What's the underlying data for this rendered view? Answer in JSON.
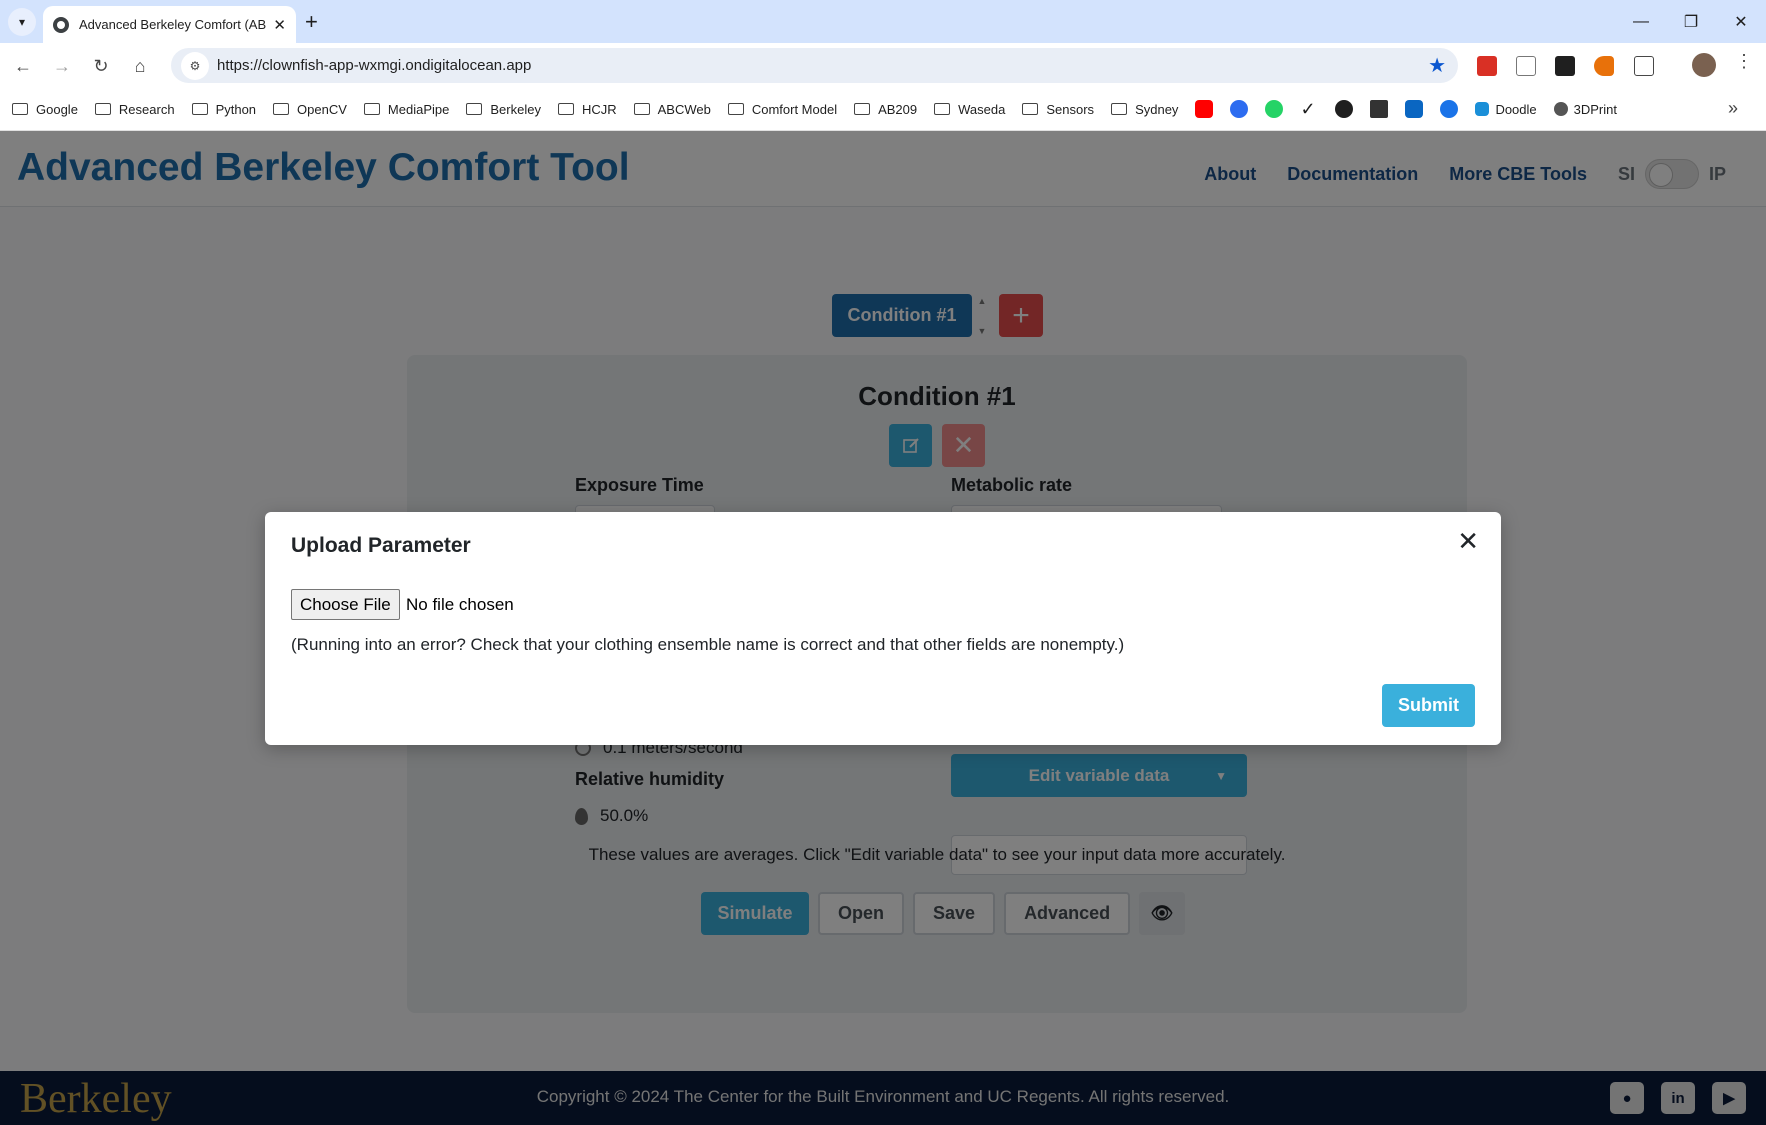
{
  "browser": {
    "tab_title": "Advanced Berkeley Comfort (AB",
    "url": "https://clownfish-app-wxmgi.ondigitalocean.app",
    "bookmarks": [
      {
        "label": "Google",
        "type": "folder"
      },
      {
        "label": "Research",
        "type": "folder"
      },
      {
        "label": "Python",
        "type": "folder"
      },
      {
        "label": "OpenCV",
        "type": "folder"
      },
      {
        "label": "MediaPipe",
        "type": "folder"
      },
      {
        "label": "Berkeley",
        "type": "folder"
      },
      {
        "label": "HCJR",
        "type": "folder"
      },
      {
        "label": "ABCWeb",
        "type": "folder"
      },
      {
        "label": "Comfort Model",
        "type": "folder"
      },
      {
        "label": "AB209",
        "type": "folder"
      },
      {
        "label": "Waseda",
        "type": "folder"
      },
      {
        "label": "Sensors",
        "type": "folder"
      },
      {
        "label": "Sydney",
        "type": "folder"
      }
    ],
    "bookmark_icons": [
      {
        "name": "youtube-bookmark-icon",
        "color": "#ff0000"
      },
      {
        "name": "zoom-bookmark-icon",
        "color": "#2d6cf0"
      },
      {
        "name": "whatsapp-bookmark-icon",
        "color": "#25d366"
      },
      {
        "name": "checkmark-bookmark-icon",
        "color": "#1f1f1f"
      },
      {
        "name": "github-bookmark-icon",
        "color": "#1f1f1f"
      },
      {
        "name": "layers-bookmark-icon",
        "color": "#333333"
      },
      {
        "name": "linkedin-bookmark-icon",
        "color": "#0a66c2"
      },
      {
        "name": "circle-bookmark-icon",
        "color": "#1a73e8"
      }
    ],
    "doodle_label": "Doodle",
    "print_label": "3DPrint"
  },
  "app": {
    "title": "Advanced Berkeley Comfort Tool",
    "nav": {
      "about": "About",
      "documentation": "Documentation",
      "more_tools": "More CBE Tools"
    },
    "units": {
      "si": "SI",
      "ip": "IP"
    },
    "condition_tab": "Condition #1",
    "condition_heading": "Condition #1",
    "labels": {
      "exposure_time": "Exposure Time",
      "metabolic_rate": "Metabolic rate",
      "relative_humidity": "Relative humidity"
    },
    "air_speed_value": "0.1 meters/second",
    "humidity_value": "50.0%",
    "edit_variable_data": "Edit variable data",
    "averages_note": "These values are averages. Click \"Edit variable data\" to see your input data more accurately.",
    "actions": {
      "simulate": "Simulate",
      "open": "Open",
      "save": "Save",
      "advanced": "Advanced"
    },
    "footer": {
      "logo": "Berkeley",
      "copyright": "Copyright © 2024 The Center for the Built Environment and UC Regents. All rights reserved."
    }
  },
  "modal": {
    "title": "Upload Parameter",
    "choose_file": "Choose File",
    "no_file": "No file chosen",
    "hint": "(Running into an error? Check that your clothing ensemble name is correct and that other fields are nonempty.)",
    "submit": "Submit"
  },
  "colors": {
    "brand_blue": "#1f6fad",
    "accent_cyan": "#3ab0dc",
    "danger_red": "#e74c4c",
    "footer_navy": "#0a1a3a",
    "berkeley_gold": "#c4a34a"
  }
}
